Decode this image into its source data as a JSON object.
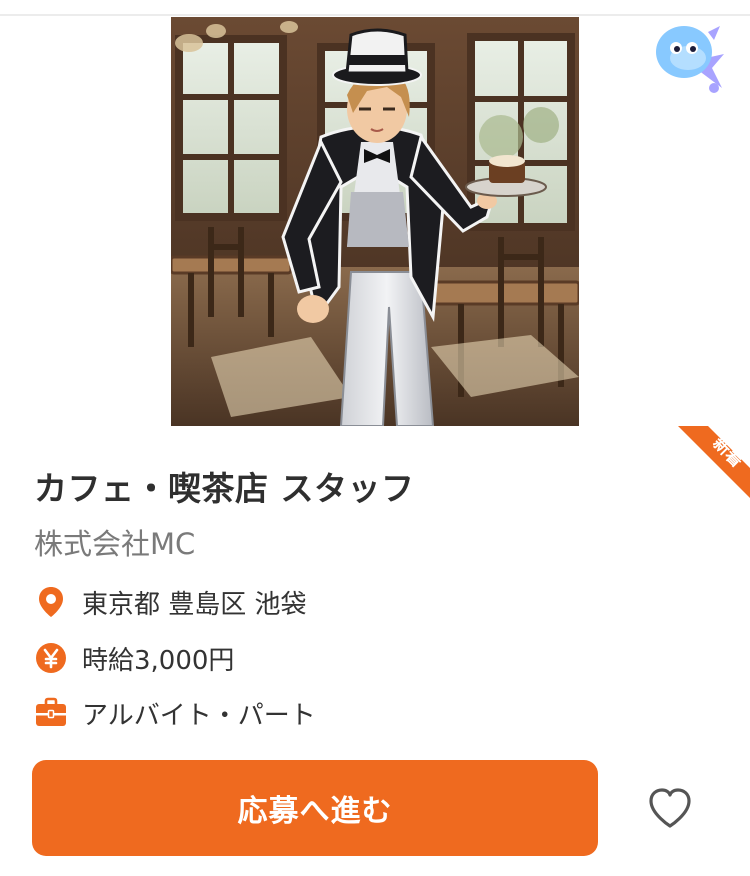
{
  "job": {
    "badge": "新着",
    "title": "カフェ・喫茶店 スタッフ",
    "company": "株式会社MC",
    "location": "東京都 豊島区 池袋",
    "wage": "時給3,000円",
    "employment_type": "アルバイト・パート"
  },
  "actions": {
    "apply_label": "応募へ進む"
  },
  "icons": {
    "location": "map-pin-icon",
    "wage": "yen-icon",
    "employment_type": "briefcase-icon",
    "favorite": "heart-outline-icon",
    "mascot": "mascot-icon"
  },
  "colors": {
    "accent": "#ef6a1f",
    "title_text": "#2f2f2f",
    "secondary_text": "#7a7a7a",
    "body_text": "#333333"
  }
}
